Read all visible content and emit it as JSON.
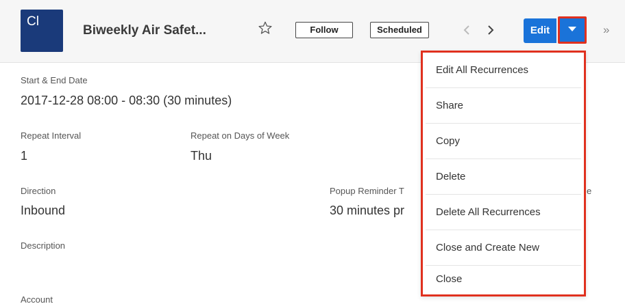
{
  "header": {
    "module_initials": "Cl",
    "record_title": "Biweekly Air Safet...",
    "favorite_icon": "star-outline-icon",
    "follow_label": "Follow",
    "status_label": "Scheduled",
    "prev_icon": "chevron-left-icon",
    "next_icon": "chevron-right-icon",
    "edit_label": "Edit",
    "actions_toggle_icon": "caret-down-icon",
    "more_icon": "double-chevron-right-icon",
    "highlight_color": "#e0301e",
    "primary_color": "#1a73d9",
    "module_color": "#1a3a7a"
  },
  "record": {
    "start_end": {
      "label": "Start & End Date",
      "value": "2017-12-28 08:00 - 08:30 (30 minutes)"
    },
    "repeat_interval": {
      "label": "Repeat Interval",
      "value": "1"
    },
    "repeat_days": {
      "label": "Repeat on Days of Week",
      "value": "Thu"
    },
    "direction": {
      "label": "Direction",
      "value": "Inbound"
    },
    "popup_reminder": {
      "label": "Popup Reminder T",
      "value": "30 minutes pr"
    },
    "right_label_fragment": "e",
    "description": {
      "label": "Description",
      "value": ""
    },
    "account": {
      "label": "Account"
    }
  },
  "actions_menu": {
    "items": [
      "Edit All Recurrences",
      "Share",
      "Copy",
      "Delete",
      "Delete All Recurrences",
      "Close and Create New",
      "Close"
    ]
  }
}
